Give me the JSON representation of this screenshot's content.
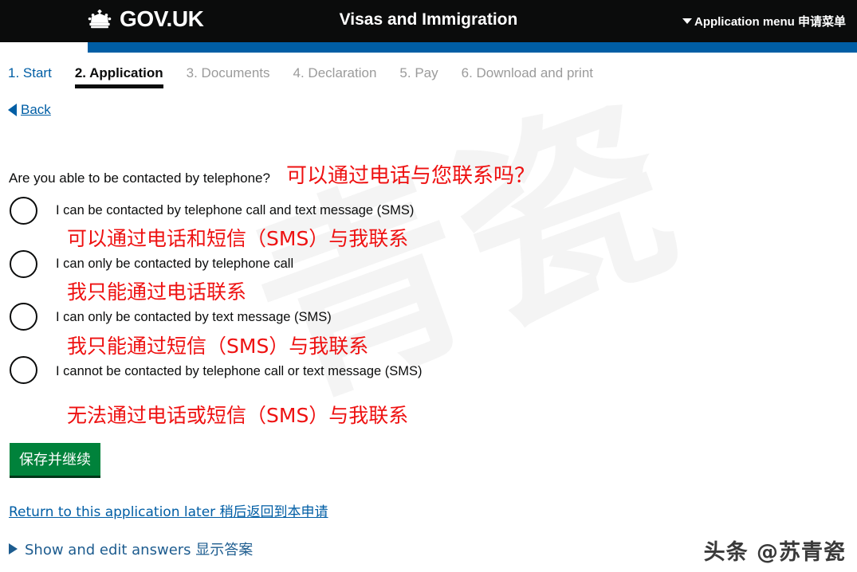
{
  "header": {
    "brand": "GOV.UK",
    "crown_icon": "crown-icon",
    "title": "Visas and Immigration",
    "app_menu_label": "Application menu 申请菜单",
    "caret_icon": "chevron-down-icon",
    "bar_color": "#0b0c0c",
    "strip_color": "#005ea5"
  },
  "tabs": [
    {
      "label": "1. Start",
      "state": "link"
    },
    {
      "label": "2. Application",
      "state": "active"
    },
    {
      "label": "3. Documents",
      "state": "muted"
    },
    {
      "label": "4. Declaration",
      "state": "muted"
    },
    {
      "label": "5. Pay",
      "state": "muted"
    },
    {
      "label": "6. Download and print",
      "state": "muted"
    }
  ],
  "back": {
    "label": "Back",
    "icon": "triangle-left-icon"
  },
  "question": {
    "english": "Are you able to be contacted by telephone?",
    "chinese": "可以通过电话与您联系吗？"
  },
  "options": [
    {
      "english": "I can be contacted by telephone call and text message (SMS)",
      "chinese": "可以通过电话和短信（SMS）与我联系",
      "selected": false
    },
    {
      "english": "I can only be contacted by telephone call",
      "chinese": "我只能通过电话联系",
      "selected": false
    },
    {
      "english": "I can only be contacted by text message (SMS)",
      "chinese": "我只能通过短信（SMS）与我联系",
      "selected": false
    },
    {
      "english": "I cannot be contacted by telephone call or text message (SMS)",
      "chinese": "无法通过电话或短信（SMS）与我联系",
      "selected": false
    }
  ],
  "save_button": {
    "label": "保存并继续",
    "color": "#00823b"
  },
  "return_link": {
    "label": "Return to this application later 稍后返回到本申请"
  },
  "show_answers": {
    "label": "Show and edit answers 显示答案",
    "icon": "triangle-right-icon"
  },
  "watermark": {
    "corner": "头条 @苏青瓷",
    "background": "青瓷"
  },
  "colors": {
    "link": "#005ea5",
    "red": "#ee1111",
    "black": "#0b0c0c",
    "muted": "#9b9b9b",
    "green": "#00823b"
  }
}
